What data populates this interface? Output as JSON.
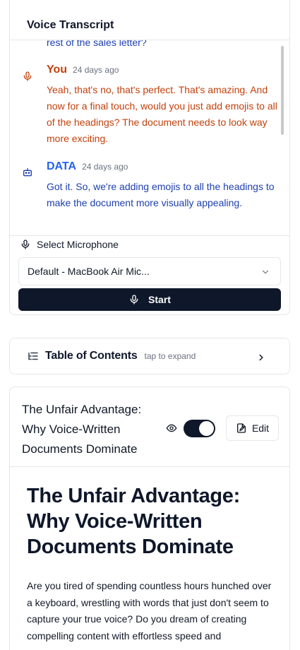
{
  "transcript": {
    "title": "Voice Transcript",
    "partial_text": "rest of the sales letter?",
    "messages": [
      {
        "speaker": "You",
        "time": "24 days ago",
        "text": "Yeah, that's no, that's perfect. That's amazing. And now for a final touch, would you just add emojis to all of the headings? The document needs to look way more exciting.",
        "icon": "microphone-icon"
      },
      {
        "speaker": "DATA",
        "time": "24 days ago",
        "text": "Got it. So, we're adding emojis to all the headings to make the document more visually appealing.",
        "icon": "bot-icon"
      }
    ],
    "mic_label": "Select Microphone",
    "mic_selected": "Default - MacBook Air Mic...",
    "start_label": "Start"
  },
  "toc": {
    "title": "Table of Contents",
    "hint": "tap to expand"
  },
  "document": {
    "title": "The Unfair Advantage: Why Voice-Written Documents Dominate",
    "edit_label": "Edit",
    "toggle_on": true,
    "heading": "The Unfair Advantage: Why Voice-Written Documents Dominate",
    "paragraph": "Are you tired of spending countless hours hunched over a keyboard, wrestling with words that just don't seem to capture your true voice? Do you dream of creating compelling content with effortless speed and"
  },
  "colors": {
    "user": "#c2410c",
    "assistant": "#1e40af",
    "primary": "#0f172a",
    "border": "#e5e7eb"
  }
}
